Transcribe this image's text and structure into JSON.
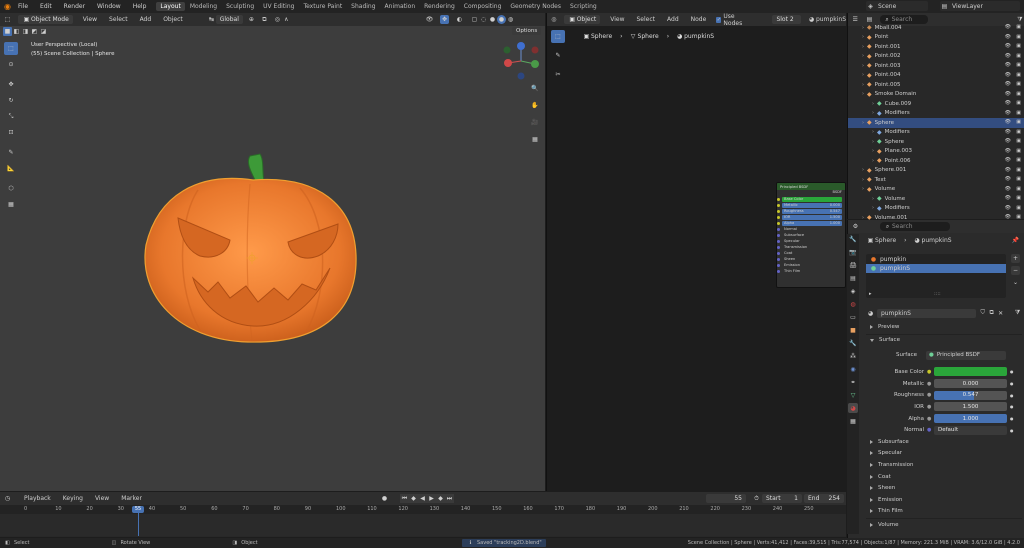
{
  "topbar": {
    "menus": [
      "File",
      "Edit",
      "Render",
      "Window",
      "Help"
    ],
    "workspaces": [
      "Layout",
      "Modeling",
      "Sculpting",
      "UV Editing",
      "Texture Paint",
      "Shading",
      "Animation",
      "Rendering",
      "Compositing",
      "Geometry Nodes",
      "Scripting"
    ],
    "active_workspace": "Layout",
    "scene": "Scene",
    "view_layer": "ViewLayer"
  },
  "viewport": {
    "mode": "Object Mode",
    "menus": [
      "View",
      "Select",
      "Add",
      "Object"
    ],
    "transform_orientation": "Global",
    "options_label": "Options",
    "info_line1": "User Perspective (Local)",
    "info_line2": "(55) Scene Collection | Sphere"
  },
  "node_editor": {
    "type": "Object",
    "menus": [
      "View",
      "Select",
      "Add",
      "Node"
    ],
    "use_nodes_label": "Use Nodes",
    "slot": "Slot 2",
    "material": "pumpkinS",
    "breadcrumb": [
      "Sphere",
      "Sphere",
      "pumpkinS"
    ],
    "node_title": "Principled BSDF",
    "node_output": "BSDF",
    "node_rows": [
      "Base Color",
      "Metallic",
      "Roughness",
      "IOR",
      "Alpha",
      "Normal",
      "Subsurface",
      "Specular",
      "Transmission",
      "Coat",
      "Sheen",
      "Emission",
      "Thin Film"
    ],
    "node_values": [
      "",
      "0.000",
      "0.547",
      "1.500",
      "1.000",
      "",
      "",
      "",
      "",
      "",
      "",
      "",
      ""
    ]
  },
  "outliner": {
    "search_placeholder": "Search",
    "items": [
      {
        "name": "Mball.004",
        "indent": 0,
        "color": "#c88b55"
      },
      {
        "name": "Point",
        "indent": 0,
        "color": "#e8a060"
      },
      {
        "name": "Point.001",
        "indent": 0,
        "color": "#e8a060"
      },
      {
        "name": "Point.002",
        "indent": 0,
        "color": "#e8a060"
      },
      {
        "name": "Point.003",
        "indent": 0,
        "color": "#e8a060"
      },
      {
        "name": "Point.004",
        "indent": 0,
        "color": "#e8a060"
      },
      {
        "name": "Point.005",
        "indent": 0,
        "color": "#e8a060"
      },
      {
        "name": "Smoke Domain",
        "indent": 0,
        "color": "#e8a060"
      },
      {
        "name": "Cube.009",
        "indent": 1,
        "color": "#6fcf97"
      },
      {
        "name": "Modifiers",
        "indent": 1,
        "color": "#7fa8e0"
      },
      {
        "name": "Sphere",
        "indent": 0,
        "color": "#e8a060",
        "selected": true
      },
      {
        "name": "Modifiers",
        "indent": 1,
        "color": "#7fa8e0"
      },
      {
        "name": "Sphere",
        "indent": 1,
        "color": "#6fcf97"
      },
      {
        "name": "Plane.003",
        "indent": 1,
        "color": "#e8a060"
      },
      {
        "name": "Point.006",
        "indent": 1,
        "color": "#e8a060"
      },
      {
        "name": "Sphere.001",
        "indent": 0,
        "color": "#e8a060"
      },
      {
        "name": "Text",
        "indent": 0,
        "color": "#e8a060"
      },
      {
        "name": "Volume",
        "indent": 0,
        "color": "#e8a060"
      },
      {
        "name": "Volume",
        "indent": 1,
        "color": "#6fcf97"
      },
      {
        "name": "Modifiers",
        "indent": 1,
        "color": "#7fa8e0"
      },
      {
        "name": "Volume.001",
        "indent": 0,
        "color": "#e8a060"
      }
    ]
  },
  "properties": {
    "search_placeholder": "Search",
    "breadcrumb": [
      "Sphere",
      "pumpkinS"
    ],
    "slots": [
      "pumpkin",
      "pumpkinS"
    ],
    "active_slot": "pumpkinS",
    "material_name": "pumpkinS",
    "sections": {
      "preview": "Preview",
      "surface": "Surface",
      "volume": "Volume"
    },
    "surface_label": "Surface",
    "surface_value": "Principled BSDF",
    "fields": [
      {
        "label": "Base Color",
        "value": "",
        "kind": "color"
      },
      {
        "label": "Metallic",
        "value": "0.000",
        "kind": "num"
      },
      {
        "label": "Roughness",
        "value": "0.547",
        "kind": "bar",
        "fill": 0.547
      },
      {
        "label": "IOR",
        "value": "1.500",
        "kind": "num"
      },
      {
        "label": "Alpha",
        "value": "1.000",
        "kind": "bar",
        "fill": 1.0
      },
      {
        "label": "Normal",
        "value": "Default",
        "kind": "link"
      }
    ],
    "subsections": [
      "Subsurface",
      "Specular",
      "Transmission",
      "Coat",
      "Sheen",
      "Emission",
      "Thin Film"
    ],
    "base_color_hex": "#2aa63a"
  },
  "timeline": {
    "menus": [
      "Playback",
      "Keying",
      "View",
      "Marker"
    ],
    "current_frame": "55",
    "start_label": "Start",
    "start": "1",
    "end_label": "End",
    "end": "254",
    "ticks": [
      "0",
      "10",
      "20",
      "30",
      "40",
      "50",
      "60",
      "70",
      "80",
      "90",
      "100",
      "110",
      "120",
      "130",
      "140",
      "150",
      "160",
      "170",
      "180",
      "190",
      "200",
      "210",
      "220",
      "230",
      "240",
      "250"
    ]
  },
  "statusbar": {
    "select": "Select",
    "rotate": "Rotate View",
    "object": "Object",
    "saved": "Saved \"tracking2D.blend\"",
    "stats": "Scene Collection | Sphere | Verts:41,412 | Faces:39,515 | Tris:77,574 | Objects:1/87 | Memory: 221.3 MiB | VRAM: 3.6/12.0 GiB | 4.2.0"
  },
  "colors": {
    "accent": "#4772b3",
    "pumpkin": "#e8772c",
    "stem": "#3d9a38",
    "selection_outline": "#f0a030"
  }
}
